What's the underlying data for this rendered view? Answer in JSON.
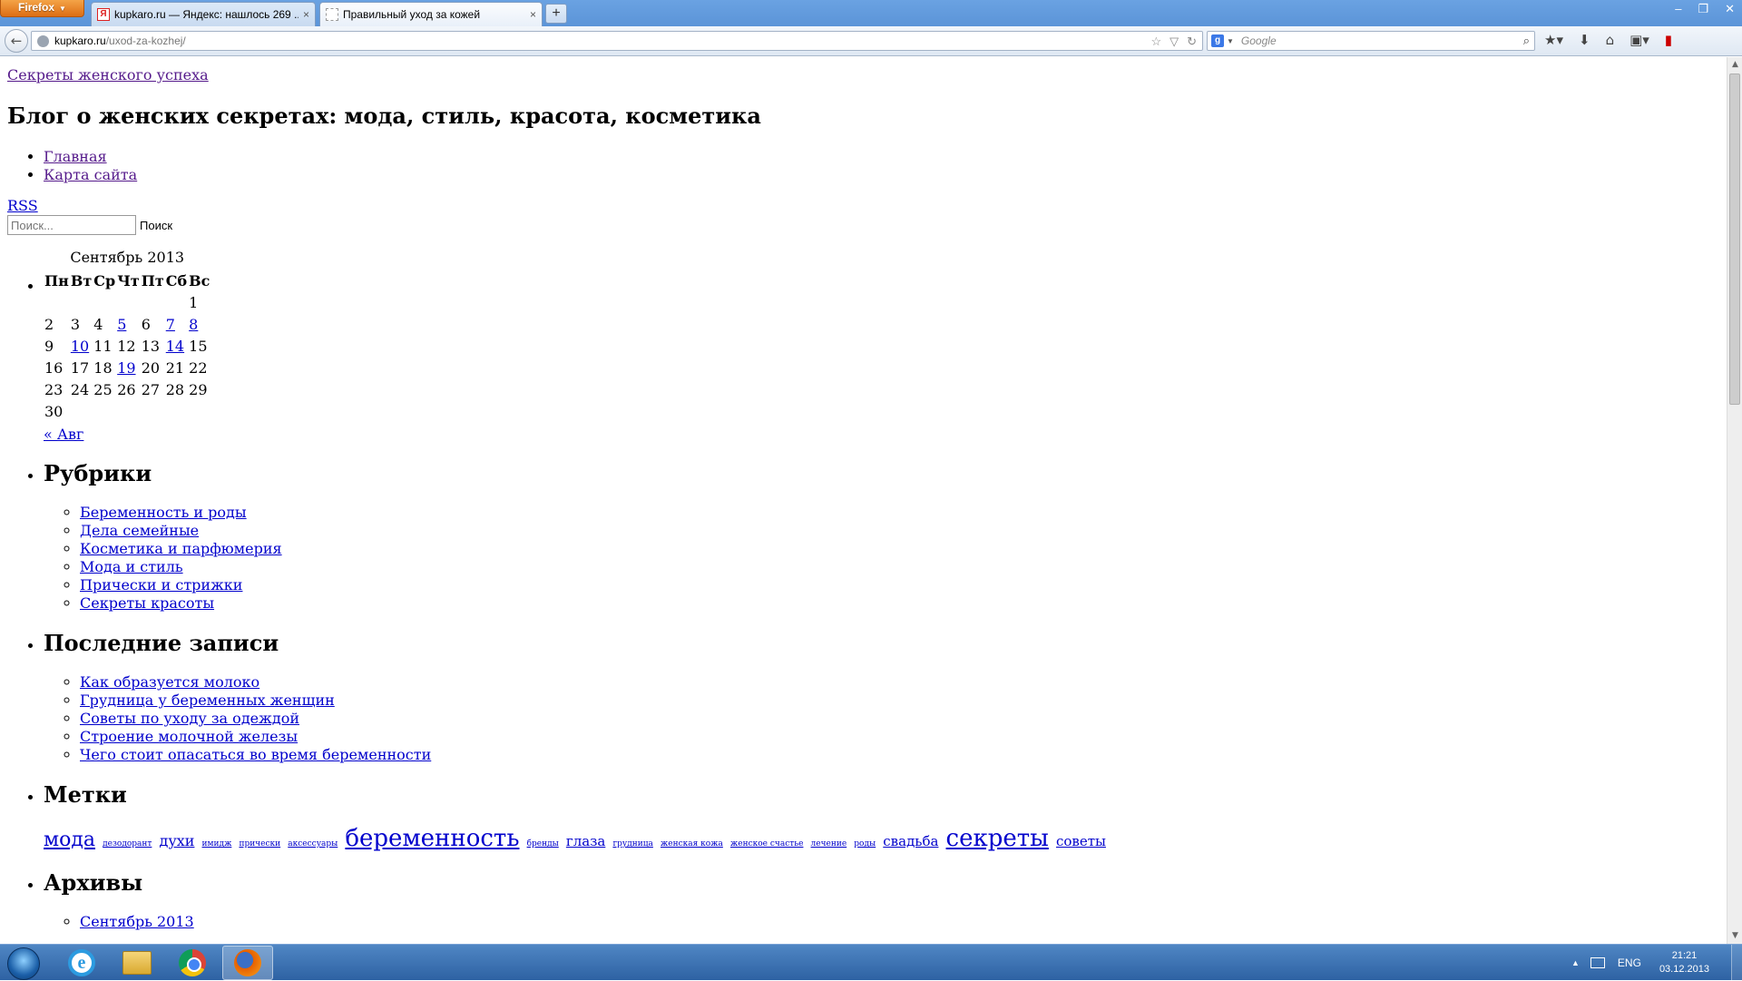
{
  "browser": {
    "app_button": "Firefox",
    "tabs": [
      {
        "label": "kupkaro.ru — Яндекс: нашлось 269 ...",
        "close": "×"
      },
      {
        "label": "Правильный уход за кожей",
        "close": "×"
      }
    ],
    "new_tab": "+",
    "window_controls": {
      "minimize": "–",
      "restore": "❐",
      "close": "✕"
    },
    "url_host": "kupkaro.ru",
    "url_path": "/uxod-za-kozhej/",
    "search_placeholder": "Google"
  },
  "page": {
    "site_name": "Секреты женского успеха",
    "blog_title": "Блог о женских секретах: мода, стиль, красота, косметика",
    "menu": [
      {
        "label": "Главная"
      },
      {
        "label": "Карта сайта"
      }
    ],
    "rss": "RSS",
    "search": {
      "placeholder": "Поиск...",
      "button": "Поиск"
    },
    "calendar": {
      "caption": "Сентябрь 2013",
      "days": [
        "Пн",
        "Вт",
        "Ср",
        "Чт",
        "Пт",
        "Сб",
        "Вс"
      ],
      "weeks": [
        [
          "",
          "",
          "",
          "",
          "",
          "",
          "1"
        ],
        [
          "2",
          "3",
          "4",
          "5",
          "6",
          "7",
          "8"
        ],
        [
          "9",
          "10",
          "11",
          "12",
          "13",
          "14",
          "15"
        ],
        [
          "16",
          "17",
          "18",
          "19",
          "20",
          "21",
          "22"
        ],
        [
          "23",
          "24",
          "25",
          "26",
          "27",
          "28",
          "29"
        ],
        [
          "30",
          "",
          "",
          "",
          "",
          "",
          ""
        ]
      ],
      "linked_days": [
        "5",
        "7",
        "8",
        "10",
        "14",
        "19"
      ],
      "prev": "« Авг"
    },
    "categories": {
      "title": "Рубрики",
      "items": [
        "Беременность и роды",
        "Дела семейные",
        "Косметика и парфюмерия",
        "Мода и стиль",
        "Прически и стрижки",
        "Секреты красоты"
      ]
    },
    "recent": {
      "title": "Последние записи",
      "items": [
        "Как образуется молоко",
        "Грудница у беременных женщин",
        "Советы по уходу за одеждой",
        "Строение молочной железы",
        "Чего стоит опасаться во время беременности"
      ]
    },
    "tags": {
      "title": "Метки",
      "items": [
        {
          "label": "мода",
          "size": 22
        },
        {
          "label": "дезодорант",
          "size": 9
        },
        {
          "label": "духи",
          "size": 16
        },
        {
          "label": "имидж",
          "size": 9
        },
        {
          "label": "прически",
          "size": 9
        },
        {
          "label": "аксессуары",
          "size": 9
        },
        {
          "label": "беременность",
          "size": 26
        },
        {
          "label": "бренды",
          "size": 9
        },
        {
          "label": "глаза",
          "size": 15
        },
        {
          "label": "грудница",
          "size": 9
        },
        {
          "label": "женская кожа",
          "size": 9
        },
        {
          "label": "женское счастье",
          "size": 9
        },
        {
          "label": "лечение",
          "size": 9
        },
        {
          "label": "роды",
          "size": 9
        },
        {
          "label": "свадьба",
          "size": 15
        },
        {
          "label": "секреты",
          "size": 26
        },
        {
          "label": "советы",
          "size": 15
        }
      ]
    },
    "archives": {
      "title": "Архивы",
      "items": [
        "Сентябрь 2013"
      ]
    }
  },
  "taskbar": {
    "apps": [
      "Internet Explorer",
      "Проводник",
      "Google Chrome",
      "Firefox"
    ],
    "lang": "ENG",
    "time": "21:21",
    "date": "03.12.2013"
  }
}
